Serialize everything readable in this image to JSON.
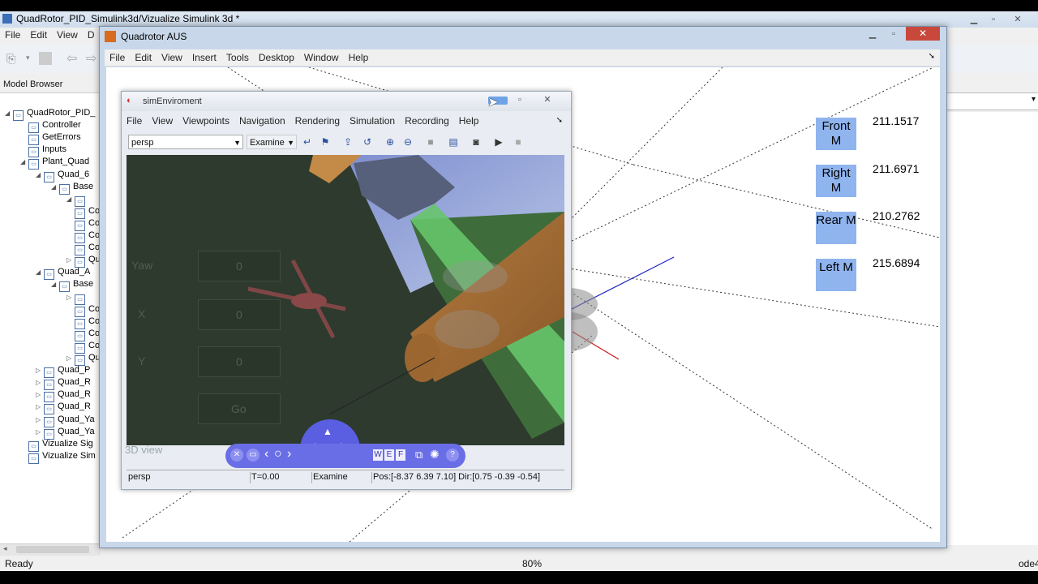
{
  "simulink": {
    "title": "QuadRotor_PID_Simulink3d/Vizualize Simulink 3d *",
    "menu": [
      "File",
      "Edit",
      "View",
      "D"
    ],
    "model_browser_label": "Model Browser",
    "tree": [
      {
        "label": "QuadRotor_PID_",
        "level": 0,
        "expander": "◢"
      },
      {
        "label": "Controller",
        "level": 1,
        "expander": ""
      },
      {
        "label": "GetErrors",
        "level": 1,
        "expander": ""
      },
      {
        "label": "Inputs",
        "level": 1,
        "expander": ""
      },
      {
        "label": "Plant_Quad",
        "level": 1,
        "expander": "◢"
      },
      {
        "label": "Quad_6",
        "level": 2,
        "expander": "◢"
      },
      {
        "label": "Base",
        "level": 3,
        "expander": "◢"
      },
      {
        "label": "",
        "level": 4,
        "expander": "◢"
      },
      {
        "label": "Con",
        "level": 4,
        "expander": ""
      },
      {
        "label": "Con",
        "level": 4,
        "expander": ""
      },
      {
        "label": "Con",
        "level": 4,
        "expander": ""
      },
      {
        "label": "Con",
        "level": 4,
        "expander": ""
      },
      {
        "label": "Qua",
        "level": 4,
        "expander": "▷"
      },
      {
        "label": "Quad_A",
        "level": 2,
        "expander": "◢"
      },
      {
        "label": "Base",
        "level": 3,
        "expander": "◢"
      },
      {
        "label": "",
        "level": 4,
        "expander": "▷"
      },
      {
        "label": "Con",
        "level": 4,
        "expander": ""
      },
      {
        "label": "Con",
        "level": 4,
        "expander": ""
      },
      {
        "label": "Con",
        "level": 4,
        "expander": ""
      },
      {
        "label": "Con",
        "level": 4,
        "expander": ""
      },
      {
        "label": "Qua",
        "level": 4,
        "expander": "▷"
      },
      {
        "label": "Quad_P",
        "level": 2,
        "expander": "▷"
      },
      {
        "label": "Quad_R",
        "level": 2,
        "expander": "▷"
      },
      {
        "label": "Quad_R",
        "level": 2,
        "expander": "▷"
      },
      {
        "label": "Quad_R",
        "level": 2,
        "expander": "▷"
      },
      {
        "label": "Quad_Ya",
        "level": 2,
        "expander": "▷"
      },
      {
        "label": "Quad_Ya",
        "level": 2,
        "expander": "▷"
      },
      {
        "label": "Vizualize Sig",
        "level": 1,
        "expander": ""
      },
      {
        "label": "Vizualize Sim",
        "level": 1,
        "expander": ""
      }
    ],
    "status_left": "Ready",
    "status_zoom": "80%",
    "status_solver": "ode4"
  },
  "figure": {
    "title": "Quadrotor AUS",
    "menu": [
      "File",
      "Edit",
      "View",
      "Insert",
      "Tools",
      "Desktop",
      "Window",
      "Help"
    ],
    "motors": [
      {
        "label_line1": "Front",
        "label_line2": "M",
        "value": "211.1517"
      },
      {
        "label_line1": "Right",
        "label_line2": "M",
        "value": "211.6971"
      },
      {
        "label_line1": "Rear M",
        "label_line2": "",
        "value": "210.2762"
      },
      {
        "label_line1": "Left M",
        "label_line2": "",
        "value": "215.6894"
      }
    ],
    "label_color": "#8fb4ee"
  },
  "sim": {
    "title": "simEnviroment",
    "menu": [
      "File",
      "View",
      "Viewpoints",
      "Navigation",
      "Rendering",
      "Simulation",
      "Recording",
      "Help"
    ],
    "viewpoint": "persp",
    "nav_mode": "Examine",
    "ghost_labels": {
      "yaw": "Yaw",
      "x": "X",
      "y": "Y",
      "yaw_val": "0",
      "x_val": "0",
      "y_val": "0",
      "go": "Go",
      "view": "3D view"
    },
    "status": {
      "viewpoint": "persp",
      "time": "T=0.00",
      "mode": "Examine",
      "pos": "Pos:[-8.37 6.39 7.10] Dir:[0.75 -0.39 -0.54]"
    },
    "nav_letters": [
      "W",
      "E",
      "F"
    ]
  }
}
